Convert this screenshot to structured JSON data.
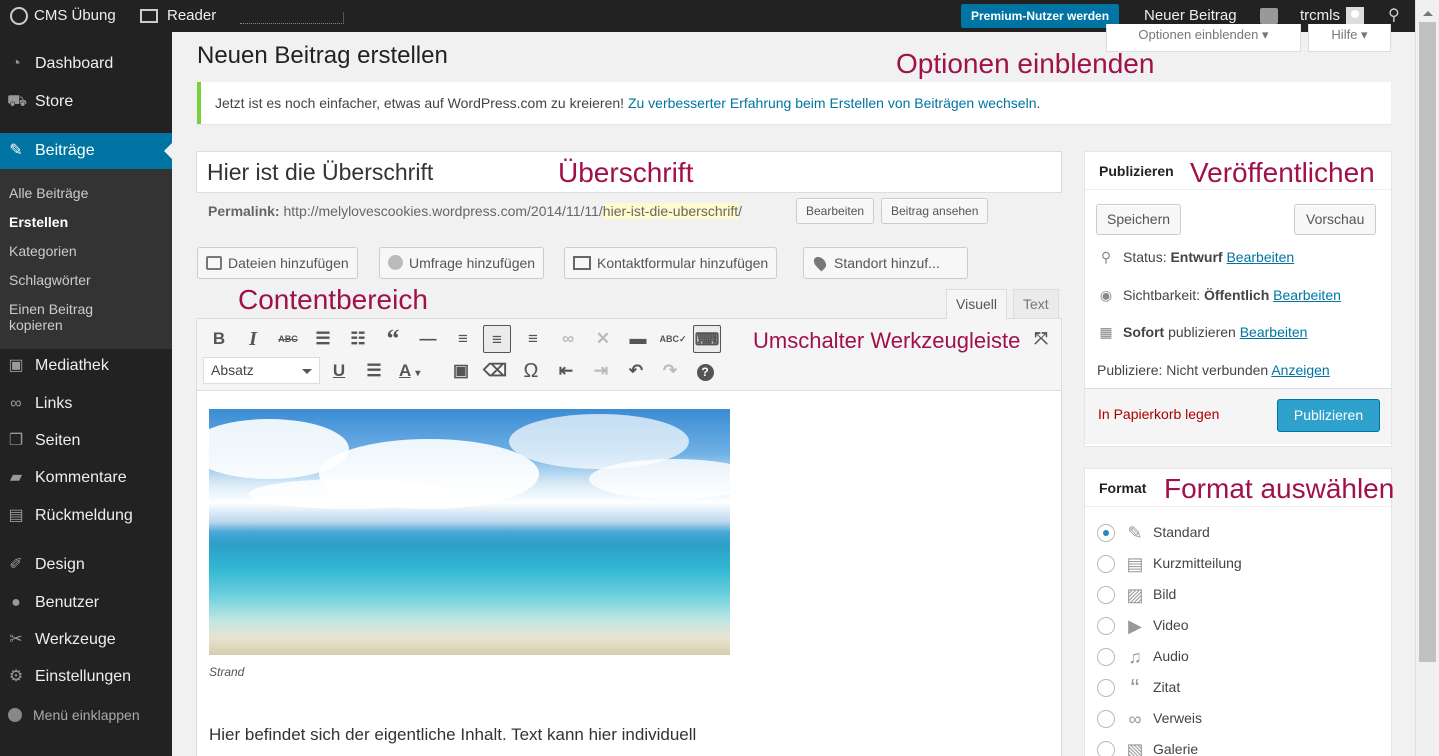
{
  "adminbar": {
    "site": "CMS Übung",
    "reader": "Reader",
    "premium": "Premium-Nutzer werden",
    "new_post": "Neuer Beitrag",
    "user": "trcmls"
  },
  "menu": {
    "dashboard": "Dashboard",
    "store": "Store",
    "posts": "Beiträge",
    "sub": [
      "Alle Beiträge",
      "Erstellen",
      "Kategorien",
      "Schlagwörter",
      "Einen Beitrag kopieren"
    ],
    "media": "Mediathek",
    "links": "Links",
    "pages": "Seiten",
    "comments": "Kommentare",
    "feedback": "Rückmeldung",
    "design": "Design",
    "users": "Benutzer",
    "tools": "Werkzeuge",
    "settings": "Einstellungen",
    "collapse": "Menü einklappen"
  },
  "page": {
    "title": "Neuen Beitrag erstellen",
    "screen_options": "Optionen einblenden ▾",
    "help": "Hilfe ▾"
  },
  "annotations": {
    "options": "Optionen einblenden",
    "headline": "Überschrift",
    "publish": "Veröffentlichen",
    "content": "Contentbereich",
    "toolbar_toggle": "Umschalter Werkzeugleiste",
    "format": "Format auswählen"
  },
  "notice": {
    "text": "Jetzt ist es noch einfacher, etwas auf WordPress.com zu kreieren! ",
    "link": "Zu verbesserter Erfahrung beim Erstellen von Beiträgen wechseln",
    "suffix": "."
  },
  "post": {
    "title_value": "Hier ist die Überschrift",
    "permalink_label": "Permalink:",
    "permalink_base": " http://melylovescookies.wordpress.com/2014/11/11/",
    "permalink_slug": "hier-ist-die-uberschrift",
    "permalink_end": "/",
    "edit_button": "Bearbeiten",
    "view_button": "Beitrag ansehen"
  },
  "media_buttons": {
    "files": "Dateien hinzufügen",
    "poll": "Umfrage hinzufügen",
    "contact": "Kontaktformular hinzufügen",
    "location": "Standort hinzuf..."
  },
  "editor": {
    "tab_visual": "Visuell",
    "tab_text": "Text",
    "format_select": "Absatz",
    "image_caption": "Strand",
    "body_line1": "Hier befindet sich der eigentliche Inhalt. Text kann hier individuell"
  },
  "publish_box": {
    "title": "Publizieren",
    "save": "Speichern",
    "preview": "Vorschau",
    "status_label": "Status: ",
    "status_value": "Entwurf",
    "visibility_label": "Sichtbarkeit: ",
    "visibility_value": "Öffentlich",
    "schedule_value": "Sofort",
    "schedule_label": " publizieren",
    "edit": "Bearbeiten",
    "connection_label": "Publiziere: Nicht verbunden ",
    "connection_link": "Anzeigen",
    "trash": "In Papierkorb legen",
    "publish": "Publizieren"
  },
  "format_box": {
    "title": "Format",
    "options": [
      "Standard",
      "Kurzmitteilung",
      "Bild",
      "Video",
      "Audio",
      "Zitat",
      "Verweis",
      "Galerie"
    ],
    "selected": "Standard"
  },
  "colors": {
    "accent": "#0074a2",
    "annotation": "#a0114a",
    "notice_border": "#7ad03a",
    "adminbar": "#222222"
  }
}
